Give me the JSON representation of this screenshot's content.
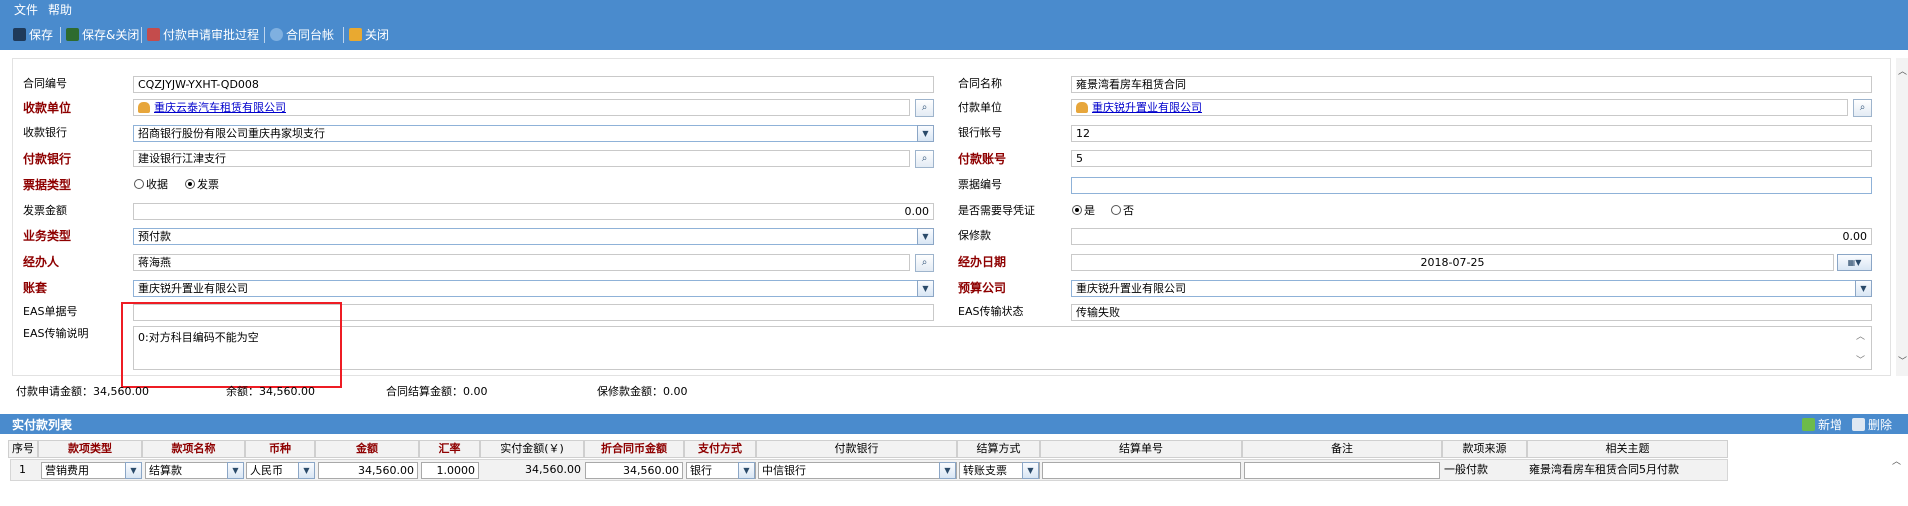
{
  "menu": [
    "文件",
    "帮助"
  ],
  "toolbar": {
    "save": "保存",
    "save_close": "保存&关闭",
    "approval_process": "付款申请审批过程",
    "contract_ledger": "合同台帐",
    "close": "关闭"
  },
  "form": {
    "contract_no": {
      "label": "合同编号",
      "value": "CQZJYJW-YXHT-QD008"
    },
    "contract_name": {
      "label": "合同名称",
      "value": "雍景湾看房车租赁合同"
    },
    "payee": {
      "label": "收款单位",
      "value": "重庆云泰汽车租赁有限公司"
    },
    "payer": {
      "label": "付款单位",
      "value": "重庆锐升置业有限公司"
    },
    "payee_bank": {
      "label": "收款银行",
      "value": "招商银行股份有限公司重庆冉家坝支行"
    },
    "bank_account": {
      "label": "银行帐号",
      "value": "12"
    },
    "payer_bank": {
      "label": "付款银行",
      "value": "建设银行江津支行"
    },
    "payer_account": {
      "label": "付款账号",
      "value": "5"
    },
    "invoice_type": {
      "label": "票据类型",
      "options": [
        "收据",
        "发票"
      ],
      "selected": "发票"
    },
    "invoice_no": {
      "label": "票据编号",
      "value": ""
    },
    "invoice_amount": {
      "label": "发票金额",
      "value": "0.00"
    },
    "need_voucher": {
      "label": "是否需要导凭证",
      "options": [
        "是",
        "否"
      ],
      "selected": "是"
    },
    "business_type": {
      "label": "业务类型",
      "value": "预付款"
    },
    "warranty": {
      "label": "保修款",
      "value": "0.00"
    },
    "handler": {
      "label": "经办人",
      "value": "蒋海燕"
    },
    "handle_date": {
      "label": "经办日期",
      "value": "2018-07-25"
    },
    "account_set": {
      "label": "账套",
      "value": "重庆锐升置业有限公司"
    },
    "budget_company": {
      "label": "预算公司",
      "value": "重庆锐升置业有限公司"
    },
    "eas_doc_no": {
      "label": "EAS单据号",
      "value": ""
    },
    "eas_status": {
      "label": "EAS传输状态",
      "value": "传输失败"
    },
    "eas_desc": {
      "label": "EAS传输说明",
      "value": "0:对方科目编码不能为空"
    }
  },
  "summary": {
    "apply_amount": "付款申请金额：34,560.00",
    "balance": "余额：34,560.00",
    "settlement": "合同结算金额：0.00",
    "warranty": "保修款金额：0.00"
  },
  "payment_list": {
    "title": "实付款列表",
    "add": "新增",
    "delete": "删除",
    "columns": [
      "序号",
      "款项类型",
      "款项名称",
      "币种",
      "金额",
      "汇率",
      "实付金额(￥)",
      "折合同币金额",
      "支付方式",
      "付款银行",
      "结算方式",
      "结算单号",
      "备注",
      "款项来源",
      "相关主题"
    ],
    "rows": [
      {
        "no": "1",
        "type": "营销费用",
        "name": "结算款",
        "currency": "人民币",
        "amount": "34,560.00",
        "rate": "1.0000",
        "paid": "34,560.00",
        "converted": "34,560.00",
        "method": "银行",
        "bank": "中信银行",
        "settle": "转账支票",
        "settle_no": "",
        "remark": "",
        "source": "一般付款",
        "topic": "雍景湾看房车租赁合同5月付款"
      }
    ]
  }
}
